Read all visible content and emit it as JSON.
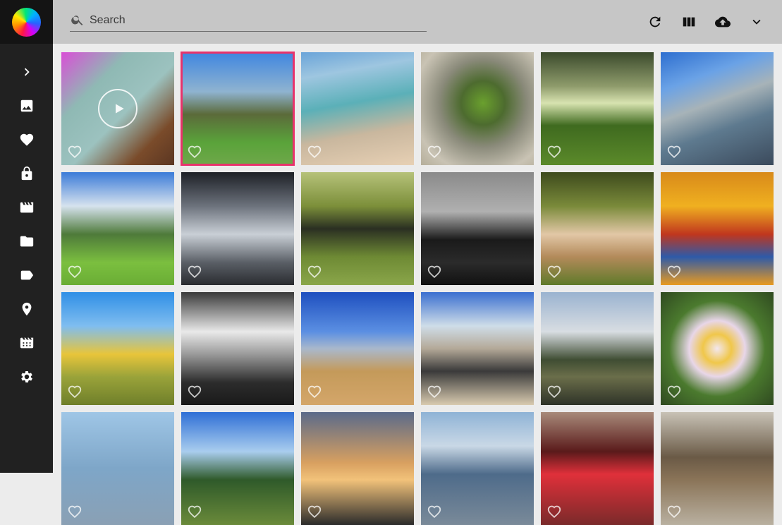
{
  "search": {
    "placeholder": "Search",
    "value": ""
  },
  "sidebar": {
    "items": [
      {
        "name": "expand",
        "icon": "chevron-right-icon"
      },
      {
        "name": "photos",
        "icon": "image-icon"
      },
      {
        "name": "favorites",
        "icon": "heart-icon"
      },
      {
        "name": "private",
        "icon": "lock-icon"
      },
      {
        "name": "videos",
        "icon": "movie-icon"
      },
      {
        "name": "folders",
        "icon": "folder-icon"
      },
      {
        "name": "labels",
        "icon": "label-icon"
      },
      {
        "name": "places",
        "icon": "location-pin-icon"
      },
      {
        "name": "albums",
        "icon": "album-icon"
      },
      {
        "name": "settings",
        "icon": "gear-icon"
      }
    ]
  },
  "toolbar": {
    "buttons": [
      {
        "name": "refresh",
        "icon": "refresh-icon"
      },
      {
        "name": "view-mode",
        "icon": "columns-icon"
      },
      {
        "name": "upload",
        "icon": "cloud-upload-icon"
      },
      {
        "name": "expand-filters",
        "icon": "chevron-down-icon"
      }
    ]
  },
  "photos": [
    {
      "id": "p01",
      "bg": "linear-gradient(135deg,#d94fd6 0%,#8fb9b4 30%,#9cc2bf 55%,#7a4b2a 80%,#5b3622 100%)",
      "is_video": true,
      "selected": false
    },
    {
      "id": "p02",
      "bg": "linear-gradient(180deg,#3f86e0 0%,#8fb3d0 35%,#5b6a3a 55%,#5aa33a 80%,#6fa84a 100%)",
      "is_video": false,
      "selected": true
    },
    {
      "id": "p03",
      "bg": "linear-gradient(170deg,#6aa4d9 0%,#9ec6e0 20%,#5bb0b8 45%,#c9b79e 70%,#e7d0b4 100%)",
      "is_video": false,
      "selected": false
    },
    {
      "id": "p04",
      "bg": "radial-gradient(circle at 55% 45%,#6aa02e 0%,#4d6b2f 25%,#8a8a7a 50%,#c9c3b4 80%,#b5ae9a 100%)",
      "is_video": false,
      "selected": false
    },
    {
      "id": "p05",
      "bg": "linear-gradient(180deg,#3b4a2c 0%,#8e9b6b 30%,#d8e3b0 45%,#3f6a1f 65%,#5b8a2a 100%)",
      "is_video": false,
      "selected": false
    },
    {
      "id": "p06",
      "bg": "linear-gradient(160deg,#2e6fd0 0%,#6aa2e6 25%,#a7b3b8 45%,#5e7a8f 65%,#3b4a5c 100%)",
      "is_video": false,
      "selected": false
    },
    {
      "id": "p07",
      "bg": "linear-gradient(180deg,#3b7bd8 0%,#d6e2ee 30%,#4e7a3a 55%,#7bbf3f 80%,#6aad35 100%)",
      "is_video": false,
      "selected": false
    },
    {
      "id": "p08",
      "bg": "linear-gradient(180deg,#1d2026 0%,#6c727c 30%,#c9cfd6 55%,#5a5f66 80%,#2a2c30 100%)",
      "is_video": false,
      "selected": false
    },
    {
      "id": "p09",
      "bg": "linear-gradient(180deg,#b6c27a 0%,#7c8f3a 30%,#2a2f22 50%,#6e8a34 75%,#8aa64a 100%)",
      "is_video": false,
      "selected": false
    },
    {
      "id": "p10",
      "bg": "linear-gradient(180deg,#8a8a8a 0%,#b0b0b0 35%,#1a1a1a 60%,#2b2b2b 80%,#111 100%)",
      "is_video": false,
      "selected": false
    },
    {
      "id": "p11",
      "bg": "linear-gradient(180deg,#3d4a1d 0%,#7a8a3a 30%,#e2c7a6 55%,#b38a5a 75%,#5f7a2a 100%)",
      "is_video": false,
      "selected": false
    },
    {
      "id": "p12",
      "bg": "linear-gradient(180deg,#d88a1a 0%,#f0b020 30%,#c0361e 55%,#2e5aa8 75%,#e89a20 100%)",
      "is_video": false,
      "selected": false
    },
    {
      "id": "p13",
      "bg": "linear-gradient(180deg,#2f8fe6 0%,#7fbdf0 30%,#e8c53a 55%,#9aa33a 75%,#6f7f2a 100%)",
      "is_video": false,
      "selected": false
    },
    {
      "id": "p14",
      "bg": "linear-gradient(180deg,#3a3a3a 0%,#e9e9e9 35%,#9a9a9a 55%,#2c2c2c 80%,#1a1a1a 100%)",
      "is_video": false,
      "selected": false
    },
    {
      "id": "p15",
      "bg": "linear-gradient(180deg,#1e4fbf 0%,#5b8fe2 35%,#a9b8cc 50%,#c49a5a 70%,#d4a66a 100%)",
      "is_video": false,
      "selected": false
    },
    {
      "id": "p16",
      "bg": "linear-gradient(180deg,#3a6fd0 0%,#cfdde8 30%,#b4a998 50%,#3a3a3a 70%,#d9cbb0 100%)",
      "is_video": false,
      "selected": false
    },
    {
      "id": "p17",
      "bg": "linear-gradient(180deg,#9ab3d0 0%,#d8dde2 35%,#3f4d33 60%,#6b6e4a 75%,#2e3328 100%)",
      "is_video": false,
      "selected": false
    },
    {
      "id": "p18",
      "bg": "radial-gradient(circle at 50% 50%,#f3e7ef 0%,#f0c74a 18%,#e8d6e8 35%,#4b7a2e 60%,#2f4a20 100%)",
      "is_video": false,
      "selected": false
    },
    {
      "id": "p19",
      "bg": "linear-gradient(180deg,#9fc6e6 0%,#7ea6c8 50%,#8aa0b4 100%)",
      "is_video": false,
      "selected": false
    },
    {
      "id": "p20",
      "bg": "linear-gradient(180deg,#2f6fd6 0%,#a9cdee 35%,#2f5a2a 60%,#6a8a3a 100%)",
      "is_video": false,
      "selected": false
    },
    {
      "id": "p21",
      "bg": "linear-gradient(180deg,#5a6a8a 0%,#d8a060 45%,#f2c27a 60%,#2b2b2b 100%)",
      "is_video": false,
      "selected": false
    },
    {
      "id": "p22",
      "bg": "linear-gradient(180deg,#8fb3d6 0%,#c9d8e6 30%,#4e6b8a 55%,#7a8a99 100%)",
      "is_video": false,
      "selected": false
    },
    {
      "id": "p23",
      "bg": "linear-gradient(180deg,#a88a7a 0%,#5a1a1a 35%,#e0303a 55%,#7a2a2a 100%)",
      "is_video": false,
      "selected": false
    },
    {
      "id": "p24",
      "bg": "linear-gradient(180deg,#c8c2b6 0%,#6a5a46 40%,#8a7458 60%,#b9b0a0 100%)",
      "is_video": false,
      "selected": false
    }
  ]
}
